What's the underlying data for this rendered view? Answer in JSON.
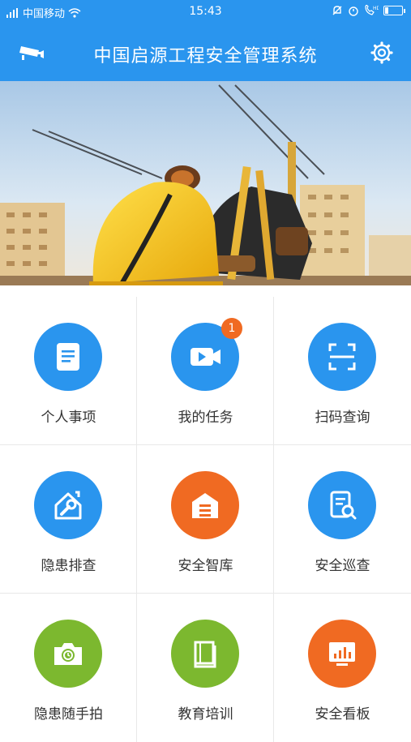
{
  "status_bar": {
    "carrier": "中国移动",
    "time": "15:43",
    "battery_level": 0.2
  },
  "header": {
    "title": "中国启源工程安全管理系统"
  },
  "menu": {
    "items": [
      {
        "label": "个人事项",
        "icon": "document-icon",
        "color": "#2a95ee"
      },
      {
        "label": "我的任务",
        "icon": "video-icon",
        "color": "#2a95ee",
        "badge": "1"
      },
      {
        "label": "扫码查询",
        "icon": "scan-icon",
        "color": "#2a95ee"
      },
      {
        "label": "隐患排查",
        "icon": "house-wrench-icon",
        "color": "#2a95ee"
      },
      {
        "label": "安全智库",
        "icon": "warehouse-icon",
        "color": "#f06a22"
      },
      {
        "label": "安全巡查",
        "icon": "doc-search-icon",
        "color": "#2a95ee"
      },
      {
        "label": "隐患随手拍",
        "icon": "camera-icon",
        "color": "#7cb82f"
      },
      {
        "label": "教育培训",
        "icon": "book-icon",
        "color": "#7cb82f"
      },
      {
        "label": "安全看板",
        "icon": "dashboard-icon",
        "color": "#f06a22"
      }
    ]
  }
}
